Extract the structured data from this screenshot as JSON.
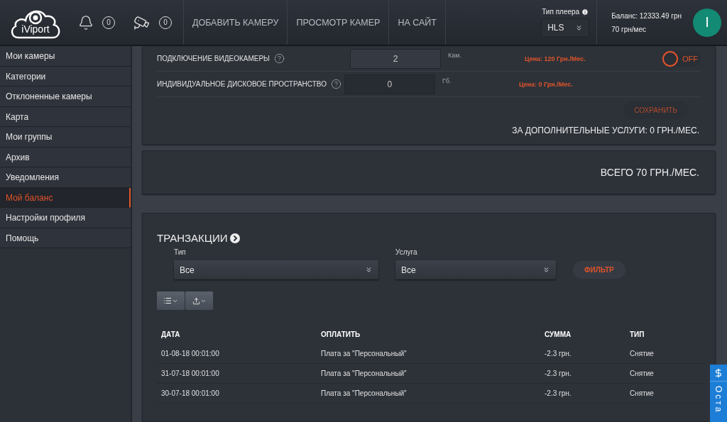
{
  "header": {
    "logo": "iViport",
    "notifications": {
      "count": "0"
    },
    "cameras": {
      "count": "0"
    },
    "nav": [
      "ДОБАВИТЬ КАМЕРУ",
      "ПРОСМОТР КАМЕР",
      "НА САЙТ"
    ],
    "player": {
      "label": "Тип плеера",
      "value": "HLS"
    },
    "balance": {
      "line1": "Баланс: 12333.49 грн",
      "line2": "70 грн/мес"
    },
    "avatar": {
      "initial": "I"
    }
  },
  "sidebar": {
    "items": [
      {
        "label": "Мои камеры",
        "selected": false
      },
      {
        "label": "Категории",
        "selected": false
      },
      {
        "label": "Отклоненные камеры",
        "selected": false
      },
      {
        "label": "Карта",
        "selected": false
      },
      {
        "label": "Мои группы",
        "selected": false
      },
      {
        "label": "Архив",
        "selected": false
      },
      {
        "label": "Уведомления",
        "selected": false
      },
      {
        "label": "Мой баланс",
        "selected": true
      },
      {
        "label": "Настройки профиля",
        "selected": false
      },
      {
        "label": "Помощь",
        "selected": false
      }
    ]
  },
  "services": {
    "rows": [
      {
        "label": "ПОДКЛЮЧЕНИЕ ВИДЕОКАМЕРЫ",
        "value": "2",
        "unit": "Кам.",
        "price": "Цена: 120 Грн./Мес.",
        "toggle": {
          "on": false,
          "label": "OFF"
        }
      },
      {
        "label": "ИНДИВИДУАЛЬНОЕ ДИСКОВОЕ ПРОСТРАНСТВО",
        "value": "0",
        "unit": "Гб.",
        "price": "Цена: 0 Грн./Мес."
      }
    ],
    "save": "СОХРАНИТЬ",
    "subtotal": "ЗА ДОПОЛНИТЕЛЬНЫЕ УСЛУГИ: 0 ГРН./МЕС."
  },
  "total": "ВСЕГО 70 ГРН./МЕС.",
  "transactions": {
    "title": "ТРАНЗАКЦИИ",
    "filters": [
      {
        "label": "Тип",
        "value": "Все"
      },
      {
        "label": "Услуга",
        "value": "Все"
      }
    ],
    "filter_button": "ФИЛЬТР",
    "table": {
      "columns": [
        "ДАТА",
        "ОПЛАТИТЬ",
        "СУММА",
        "ТИП"
      ],
      "rows": [
        [
          "01-08-18 00:01:00",
          "Плата за \"Персональный\"",
          "-2.3 грн.",
          "Снятие"
        ],
        [
          "31-07-18 00:01:00",
          "Плата за \"Персональный\"",
          "-2.3 грн.",
          "Снятие"
        ],
        [
          "30-07-18 00:01:00",
          "Плата за \"Персональный\"",
          "-2.3 грн.",
          "Снятие"
        ]
      ]
    }
  },
  "side_widget": {
    "label": "Оста"
  }
}
